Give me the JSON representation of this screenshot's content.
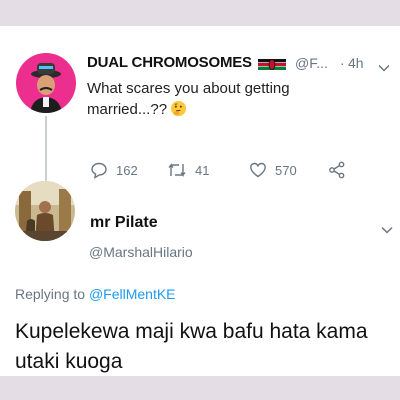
{
  "parent_tweet": {
    "author_name": "DUAL CHROMOSOMES",
    "handle": "@F...",
    "separator": "·",
    "timestamp": "4h",
    "text": "What scares you about getting married...??",
    "emoji_icon": "thinking-face-icon",
    "flag_icon": "kenya-flag-icon",
    "stats": {
      "replies": "162",
      "retweets": "41",
      "likes": "570"
    }
  },
  "reply_tweet": {
    "author_name": "mr Pilate",
    "handle": "@MarshalHilario",
    "replying_prefix": "Replying to",
    "replying_to": "@FellMentKE",
    "text": "Kupelekewa maji kwa bafu hata kama utaki kuoga"
  },
  "colors": {
    "background": "#e4dde6",
    "card": "#ffffff",
    "secondary_text": "#687684",
    "link": "#1d9bf0",
    "avatar_pink": "#ec2f8f"
  }
}
